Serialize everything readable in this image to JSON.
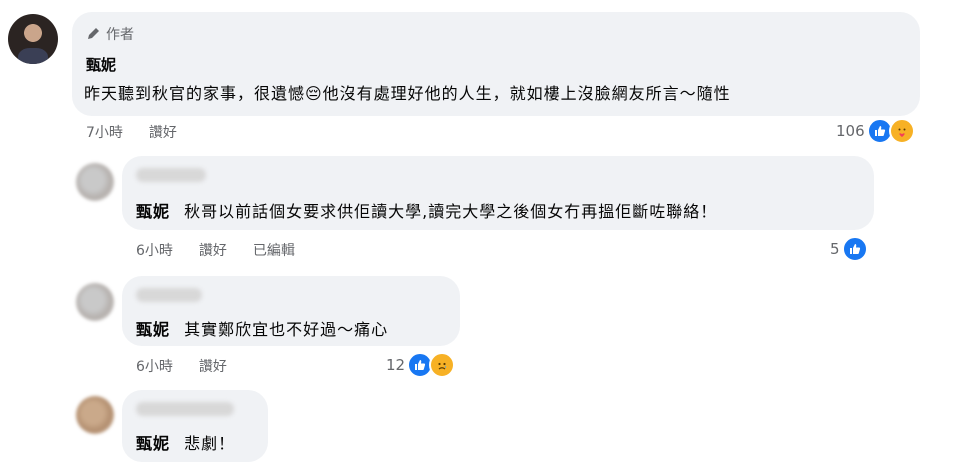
{
  "comments": [
    {
      "author_tag": "作者",
      "name": "甄妮",
      "text": "昨天聽到秋官的家事，很遺憾😔他沒有處理好他的人生，就如樓上沒臉網友所言～隨性",
      "time": "7小時",
      "like_action": "讚好",
      "reaction_count": "106",
      "reactions": [
        "like-icon",
        "care-icon"
      ]
    },
    {
      "name": "甄妮",
      "text": "秋哥以前話個女要求供佢讀大學,讀完大學之後個女冇再搵佢斷咗聯絡！",
      "time": "6小時",
      "like_action": "讚好",
      "edited": "已編輯",
      "reaction_count": "5",
      "reactions": [
        "like-icon"
      ]
    },
    {
      "name": "甄妮",
      "text": "其實鄭欣宜也不好過～痛心",
      "time": "6小時",
      "like_action": "讚好",
      "reaction_count": "12",
      "reactions": [
        "like-icon",
        "sad-icon"
      ]
    },
    {
      "name": "甄妮",
      "text": "悲劇！"
    }
  ],
  "colors": {
    "bubble": "#f0f2f5",
    "like": "#1877f2",
    "meta": "#65676b"
  }
}
